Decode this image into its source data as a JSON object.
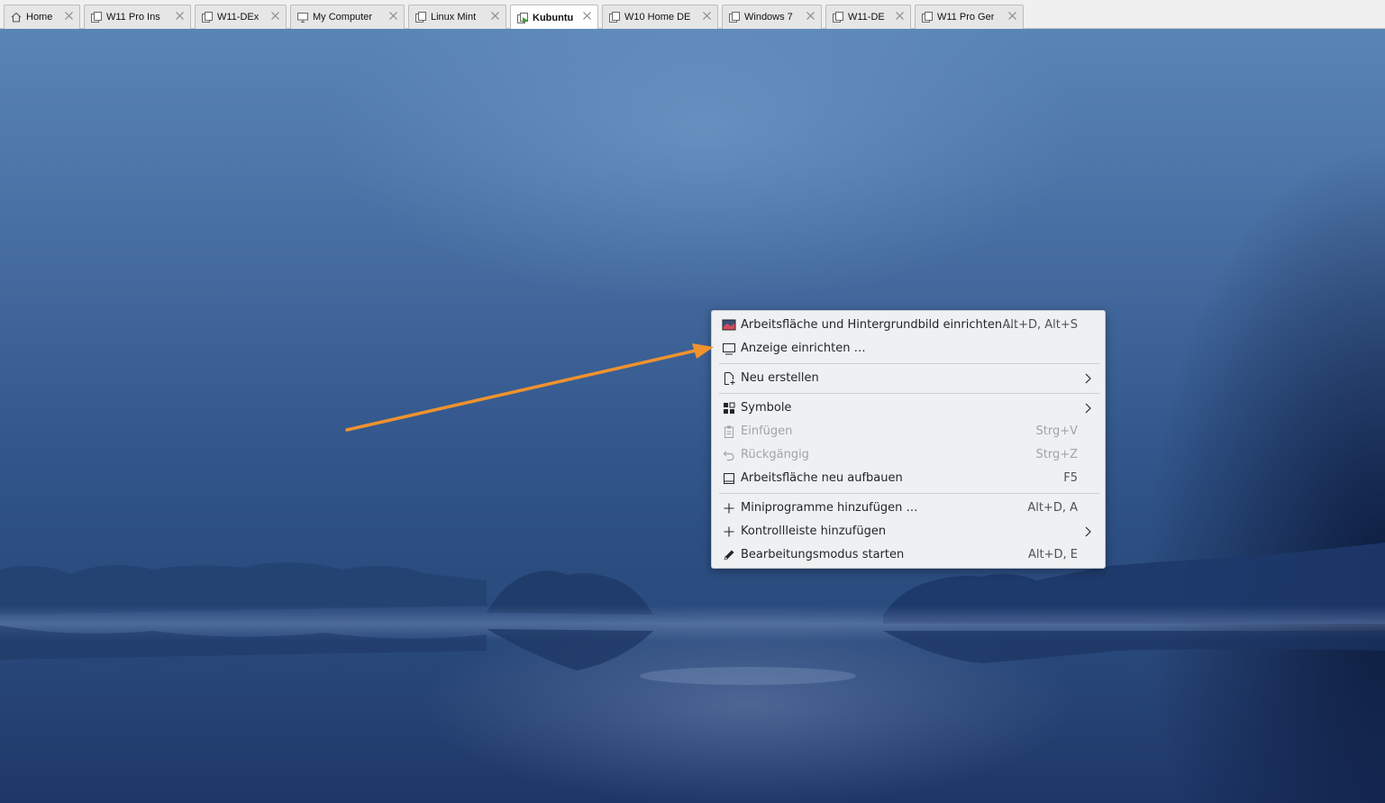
{
  "tabs": [
    {
      "label": "Home",
      "icon": "home-icon",
      "active": false
    },
    {
      "label": "W11 Pro Ins",
      "icon": "vm-icon",
      "active": false
    },
    {
      "label": "W11-DEx",
      "icon": "vm-icon",
      "active": false
    },
    {
      "label": "My Computer",
      "icon": "computer-icon",
      "active": false
    },
    {
      "label": "Linux Mint",
      "icon": "vm-icon",
      "active": false
    },
    {
      "label": "Kubuntu",
      "icon": "vm-running-icon",
      "active": true
    },
    {
      "label": "W10 Home DE",
      "icon": "vm-icon",
      "active": false
    },
    {
      "label": "Windows 7",
      "icon": "vm-icon",
      "active": false
    },
    {
      "label": "W11-DE",
      "icon": "vm-icon",
      "active": false
    },
    {
      "label": "W11 Pro Ger",
      "icon": "vm-icon",
      "active": false
    }
  ],
  "menu": {
    "items": [
      {
        "label": "Arbeitsfläche und Hintergrundbild einrichten …",
        "shortcut": "Alt+D, Alt+S",
        "icon": "wallpaper-icon",
        "enabled": true
      },
      {
        "label": "Anzeige einrichten …",
        "shortcut": "",
        "icon": "monitor-icon",
        "enabled": true
      },
      {
        "label": "Neu erstellen",
        "shortcut": "",
        "icon": "new-document-icon",
        "enabled": true,
        "submenu": true
      },
      {
        "label": "Symbole",
        "shortcut": "",
        "icon": "grid-icon",
        "enabled": true,
        "submenu": true
      },
      {
        "label": "Einfügen",
        "shortcut": "Strg+V",
        "icon": "paste-icon",
        "enabled": false
      },
      {
        "label": "Rückgängig",
        "shortcut": "Strg+Z",
        "icon": "undo-icon",
        "enabled": false
      },
      {
        "label": "Arbeitsfläche neu aufbauen",
        "shortcut": "F5",
        "icon": "refresh-desktop-icon",
        "enabled": true
      },
      {
        "label": "Miniprogramme hinzufügen …",
        "shortcut": "Alt+D, A",
        "icon": "plus-icon",
        "enabled": true
      },
      {
        "label": "Kontrollleiste hinzufügen",
        "shortcut": "",
        "icon": "plus-icon",
        "enabled": true,
        "submenu": true
      },
      {
        "label": "Bearbeitungsmodus starten",
        "shortcut": "Alt+D, E",
        "icon": "pencil-icon",
        "enabled": true
      }
    ]
  },
  "colors": {
    "annotation_arrow": "#f0922e",
    "menu_background": "#eff0f1",
    "active_tab": "#ffffff"
  }
}
